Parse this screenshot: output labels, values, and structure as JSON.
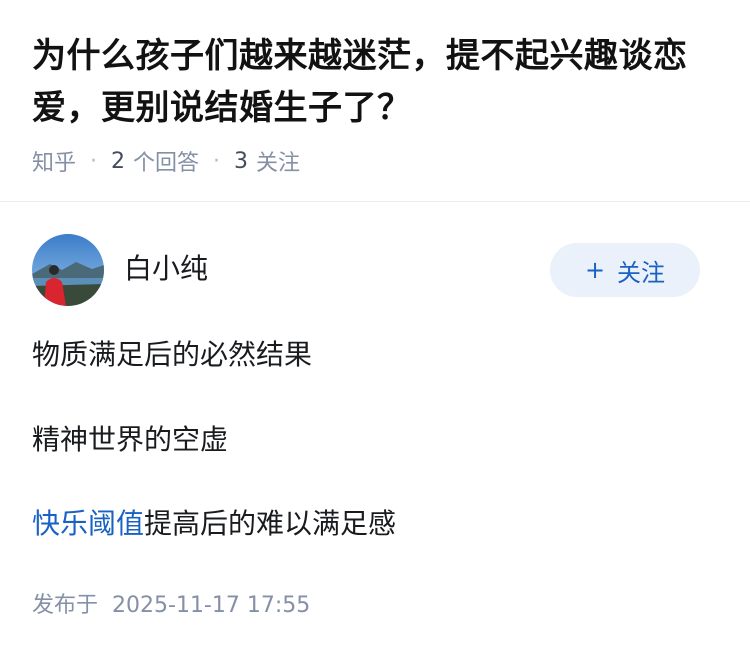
{
  "question": {
    "title": "为什么孩子们越来越迷茫，提不起兴趣谈恋爱，更别说结婚生子了？",
    "source": "知乎",
    "answer_count": "2",
    "answer_label": "个回答",
    "follow_count": "3",
    "follow_label": "关注"
  },
  "answer": {
    "author_name": "白小纯",
    "follow_button": "关注",
    "follow_icon": "plus-icon",
    "paragraphs": [
      {
        "text": "物质满足后的必然结果"
      },
      {
        "text": "精神世界的空虚"
      },
      {
        "link": "快乐阈值",
        "text": "提高后的难以满足感"
      }
    ],
    "publish_label": "发布于",
    "publish_time": "2025-11-17 17:55"
  },
  "colors": {
    "link": "#1961c4",
    "meta": "#8590a6",
    "button_bg": "#ebf1fa"
  }
}
